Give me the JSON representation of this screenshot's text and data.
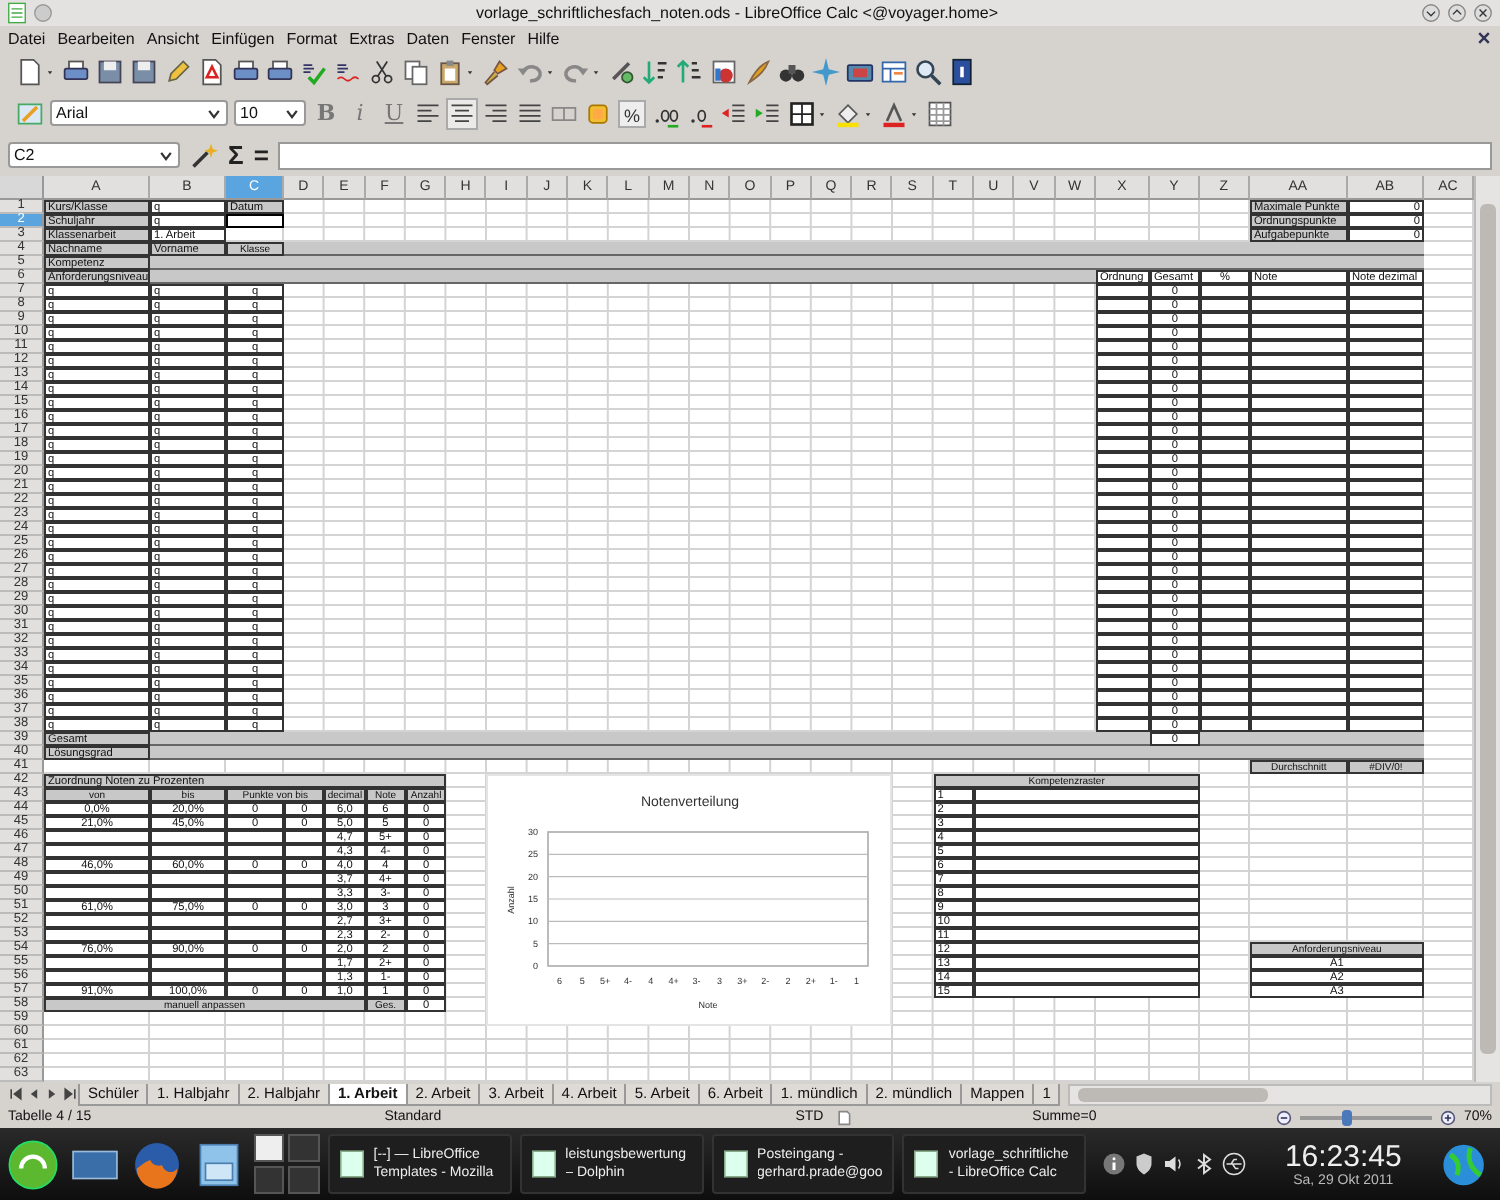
{
  "window": {
    "title": "vorlage_schriftlichesfach_noten.ods - LibreOffice Calc <@voyager.home>"
  },
  "menu": [
    "Datei",
    "Bearbeiten",
    "Ansicht",
    "Einfügen",
    "Format",
    "Extras",
    "Daten",
    "Fenster",
    "Hilfe"
  ],
  "format_toolbar": {
    "font_name": "Arial",
    "font_size": "10",
    "style_buttons": [
      {
        "label": "B",
        "kind": "bold"
      },
      {
        "label": "i",
        "kind": "italic"
      },
      {
        "label": "U",
        "kind": "underline"
      }
    ],
    "percent_button": "%"
  },
  "formula_bar": {
    "name_box": "C2",
    "buttons": [
      "Σ",
      "="
    ]
  },
  "sheet": {
    "columns": [
      {
        "label": "A",
        "selected": false
      },
      {
        "label": "B",
        "selected": false
      },
      {
        "label": "C",
        "selected": true
      },
      {
        "label": "D",
        "selected": false
      },
      {
        "label": "E",
        "selected": false
      },
      {
        "label": "F",
        "selected": false
      },
      {
        "label": "G",
        "selected": false
      },
      {
        "label": "H",
        "selected": false
      },
      {
        "label": "I",
        "selected": false
      },
      {
        "label": "J",
        "selected": false
      },
      {
        "label": "K",
        "selected": false
      },
      {
        "label": "L",
        "selected": false
      },
      {
        "label": "M",
        "selected": false
      },
      {
        "label": "N",
        "selected": false
      },
      {
        "label": "O",
        "selected": false
      },
      {
        "label": "P",
        "selected": false
      },
      {
        "label": "Q",
        "selected": false
      },
      {
        "label": "R",
        "selected": false
      },
      {
        "label": "S",
        "selected": false
      },
      {
        "label": "T",
        "selected": false
      },
      {
        "label": "U",
        "selected": false
      },
      {
        "label": "V",
        "selected": false
      },
      {
        "label": "W",
        "selected": false
      },
      {
        "label": "X",
        "selected": false
      },
      {
        "label": "Y",
        "selected": false
      },
      {
        "label": "Z",
        "selected": false
      },
      {
        "label": "AA",
        "selected": false
      },
      {
        "label": "AB",
        "selected": false
      },
      {
        "label": "AC",
        "selected": false
      }
    ],
    "row_numbers": [
      {
        "number": "1",
        "selected": false
      },
      {
        "number": "2",
        "selected": true
      },
      {
        "number": "3",
        "selected": false
      },
      {
        "number": "4",
        "selected": false
      },
      {
        "number": "5",
        "selected": false
      },
      {
        "number": "6",
        "selected": false
      },
      {
        "number": "7",
        "selected": false
      },
      {
        "number": "8",
        "selected": false
      },
      {
        "number": "9",
        "selected": false
      },
      {
        "number": "10",
        "selected": false
      },
      {
        "number": "11",
        "selected": false
      },
      {
        "number": "12",
        "selected": false
      },
      {
        "number": "13",
        "selected": false
      },
      {
        "number": "14",
        "selected": false
      },
      {
        "number": "15",
        "selected": false
      },
      {
        "number": "16",
        "selected": false
      },
      {
        "number": "17",
        "selected": false
      },
      {
        "number": "18",
        "selected": false
      },
      {
        "number": "19",
        "selected": false
      },
      {
        "number": "20",
        "selected": false
      },
      {
        "number": "21",
        "selected": false
      },
      {
        "number": "22",
        "selected": false
      },
      {
        "number": "23",
        "selected": false
      },
      {
        "number": "24",
        "selected": false
      },
      {
        "number": "25",
        "selected": false
      },
      {
        "number": "26",
        "selected": false
      },
      {
        "number": "27",
        "selected": false
      },
      {
        "number": "28",
        "selected": false
      },
      {
        "number": "29",
        "selected": false
      },
      {
        "number": "30",
        "selected": false
      },
      {
        "number": "31",
        "selected": false
      },
      {
        "number": "32",
        "selected": false
      },
      {
        "number": "33",
        "selected": false
      },
      {
        "number": "34",
        "selected": false
      },
      {
        "number": "35",
        "selected": false
      },
      {
        "number": "36",
        "selected": false
      },
      {
        "number": "37",
        "selected": false
      },
      {
        "number": "38",
        "selected": false
      },
      {
        "number": "39",
        "selected": false
      },
      {
        "number": "40",
        "selected": false
      },
      {
        "number": "41",
        "selected": false
      },
      {
        "number": "42",
        "selected": false
      },
      {
        "number": "43",
        "selected": false
      },
      {
        "number": "44",
        "selected": false
      },
      {
        "number": "45",
        "selected": false
      },
      {
        "number": "46",
        "selected": false
      },
      {
        "number": "47",
        "selected": false
      },
      {
        "number": "48",
        "selected": false
      },
      {
        "number": "49",
        "selected": false
      },
      {
        "number": "50",
        "selected": false
      },
      {
        "number": "51",
        "selected": false
      },
      {
        "number": "52",
        "selected": false
      },
      {
        "number": "53",
        "selected": false
      },
      {
        "number": "54",
        "selected": false
      },
      {
        "number": "55",
        "selected": false
      },
      {
        "number": "56",
        "selected": false
      },
      {
        "number": "57",
        "selected": false
      },
      {
        "number": "58",
        "selected": false
      },
      {
        "number": "59",
        "selected": false
      },
      {
        "number": "60",
        "selected": false
      },
      {
        "number": "61",
        "selected": false
      },
      {
        "number": "62",
        "selected": false
      },
      {
        "number": "63",
        "selected": false
      }
    ],
    "blocks": [
      {
        "kind": "info",
        "rows": [
          {
            "label": "Kurs/Klasse",
            "value": "q",
            "date_label": "Datum"
          },
          {
            "label": "Schuljahr",
            "value": "q"
          },
          {
            "label": "Klassenarbeit",
            "value": "1. Arbeit"
          }
        ]
      },
      {
        "kind": "settings",
        "rows": [
          {
            "label": "Maximale Punkte",
            "value": "0"
          },
          {
            "label": "Ordnungspunkte",
            "value": "0"
          },
          {
            "label": "Aufgabepunkte",
            "value": "0"
          }
        ]
      },
      {
        "kind": "students",
        "headers": [
          "Nachname",
          "Vorname",
          "Klasse"
        ],
        "band_labels": [
          "Kompetenz",
          "Anforderungsniveau"
        ],
        "score_headers": [
          "Ordnung",
          "Gesamt",
          "%",
          "Note",
          "Note dezimal"
        ],
        "entries": [
          {
            "last_name": "q",
            "first_name": "q",
            "class": "q",
            "total": "0"
          },
          {
            "last_name": "q",
            "first_name": "q",
            "class": "q",
            "total": "0"
          },
          {
            "last_name": "q",
            "first_name": "q",
            "class": "q",
            "total": "0"
          },
          {
            "last_name": "q",
            "first_name": "q",
            "class": "q",
            "total": "0"
          },
          {
            "last_name": "q",
            "first_name": "q",
            "class": "q",
            "total": "0"
          },
          {
            "last_name": "q",
            "first_name": "q",
            "class": "q",
            "total": "0"
          },
          {
            "last_name": "q",
            "first_name": "q",
            "class": "q",
            "total": "0"
          },
          {
            "last_name": "q",
            "first_name": "q",
            "class": "q",
            "total": "0"
          },
          {
            "last_name": "q",
            "first_name": "q",
            "class": "q",
            "total": "0"
          },
          {
            "last_name": "q",
            "first_name": "q",
            "class": "q",
            "total": "0"
          },
          {
            "last_name": "q",
            "first_name": "q",
            "class": "q",
            "total": "0"
          },
          {
            "last_name": "q",
            "first_name": "q",
            "class": "q",
            "total": "0"
          },
          {
            "last_name": "q",
            "first_name": "q",
            "class": "q",
            "total": "0"
          },
          {
            "last_name": "q",
            "first_name": "q",
            "class": "q",
            "total": "0"
          },
          {
            "last_name": "q",
            "first_name": "q",
            "class": "q",
            "total": "0"
          },
          {
            "last_name": "q",
            "first_name": "q",
            "class": "q",
            "total": "0"
          },
          {
            "last_name": "q",
            "first_name": "q",
            "class": "q",
            "total": "0"
          },
          {
            "last_name": "q",
            "first_name": "q",
            "class": "q",
            "total": "0"
          },
          {
            "last_name": "q",
            "first_name": "q",
            "class": "q",
            "total": "0"
          },
          {
            "last_name": "q",
            "first_name": "q",
            "class": "q",
            "total": "0"
          },
          {
            "last_name": "q",
            "first_name": "q",
            "class": "q",
            "total": "0"
          },
          {
            "last_name": "q",
            "first_name": "q",
            "class": "q",
            "total": "0"
          },
          {
            "last_name": "q",
            "first_name": "q",
            "class": "q",
            "total": "0"
          },
          {
            "last_name": "q",
            "first_name": "q",
            "class": "q",
            "total": "0"
          },
          {
            "last_name": "q",
            "first_name": "q",
            "class": "q",
            "total": "0"
          },
          {
            "last_name": "q",
            "first_name": "q",
            "class": "q",
            "total": "0"
          },
          {
            "last_name": "q",
            "first_name": "q",
            "class": "q",
            "total": "0"
          },
          {
            "last_name": "q",
            "first_name": "q",
            "class": "q",
            "total": "0"
          },
          {
            "last_name": "q",
            "first_name": "q",
            "class": "q",
            "total": "0"
          },
          {
            "last_name": "q",
            "first_name": "q",
            "class": "q",
            "total": "0"
          },
          {
            "last_name": "q",
            "first_name": "q",
            "class": "q",
            "total": "0"
          },
          {
            "last_name": "q",
            "first_name": "q",
            "class": "q",
            "total": "0"
          }
        ],
        "summary": [
          {
            "label": "Gesamt",
            "total": "0"
          },
          {
            "label": "Lösungsgrad"
          }
        ]
      },
      {
        "kind": "average",
        "label": "Durchschnitt",
        "value": "#DIV/0!"
      },
      {
        "kind": "grades",
        "title": "Zuordnung Noten zu Prozenten",
        "headers": [
          "von",
          "bis",
          "Punkte von bis",
          "decimal",
          "Note",
          "Anzahl"
        ],
        "rows": [
          {
            "from": "0,0%",
            "to": "20,0%",
            "points_from": "0",
            "points_to": "0",
            "decimal": "6,0",
            "grade": "6",
            "count": "0"
          },
          {
            "from": "21,0%",
            "to": "45,0%",
            "points_from": "0",
            "points_to": "0",
            "decimal": "5,0",
            "grade": "5",
            "count": "0"
          },
          {
            "decimal": "4,7",
            "grade": "5+",
            "count": "0"
          },
          {
            "decimal": "4,3",
            "grade": "4-",
            "count": "0"
          },
          {
            "from": "46,0%",
            "to": "60,0%",
            "points_from": "0",
            "points_to": "0",
            "decimal": "4,0",
            "grade": "4",
            "count": "0"
          },
          {
            "decimal": "3,7",
            "grade": "4+",
            "count": "0"
          },
          {
            "decimal": "3,3",
            "grade": "3-",
            "count": "0"
          },
          {
            "from": "61,0%",
            "to": "75,0%",
            "points_from": "0",
            "points_to": "0",
            "decimal": "3,0",
            "grade": "3",
            "count": "0"
          },
          {
            "decimal": "2,7",
            "grade": "3+",
            "count": "0"
          },
          {
            "decimal": "2,3",
            "grade": "2-",
            "count": "0"
          },
          {
            "from": "76,0%",
            "to": "90,0%",
            "points_from": "0",
            "points_to": "0",
            "decimal": "2,0",
            "grade": "2",
            "count": "0"
          },
          {
            "decimal": "1,7",
            "grade": "2+",
            "count": "0"
          },
          {
            "decimal": "1,3",
            "grade": "1-",
            "count": "0"
          },
          {
            "from": "91,0%",
            "to": "100,0%",
            "points_from": "0",
            "points_to": "0",
            "decimal": "1,0",
            "grade": "1",
            "count": "0"
          }
        ],
        "footer": {
          "label": "manuell anpassen",
          "total_label": "Ges.",
          "total": "0"
        }
      },
      {
        "kind": "competencies",
        "title": "Kompetenzraster",
        "items": [
          "1",
          "2",
          "3",
          "4",
          "5",
          "6",
          "7",
          "8",
          "9",
          "10",
          "11",
          "12",
          "13",
          "14",
          "15"
        ]
      },
      {
        "kind": "levels",
        "title": "Anforderungsniveau",
        "items": [
          "A1",
          "A2",
          "A3"
        ]
      }
    ],
    "chart_data": {
      "type": "bar",
      "title": "Notenverteilung",
      "xlabel": "Note",
      "ylabel": "Anzahl",
      "categories": [
        "6",
        "5",
        "5+",
        "4-",
        "4",
        "4+",
        "3-",
        "3",
        "3+",
        "2-",
        "2",
        "2+",
        "1-",
        "1"
      ],
      "values": [
        0,
        0,
        0,
        0,
        0,
        0,
        0,
        0,
        0,
        0,
        0,
        0,
        0,
        0
      ],
      "ylim": [
        0,
        30
      ],
      "yticks": [
        0,
        5,
        10,
        15,
        20,
        25,
        30
      ],
      "grid": true
    }
  },
  "sheet_tabs": [
    {
      "label": "Schüler",
      "selected": false
    },
    {
      "label": "1. Halbjahr",
      "selected": false
    },
    {
      "label": "2. Halbjahr",
      "selected": false
    },
    {
      "label": "1. Arbeit",
      "selected": true
    },
    {
      "label": "2. Arbeit",
      "selected": false
    },
    {
      "label": "3. Arbeit",
      "selected": false
    },
    {
      "label": "4. Arbeit",
      "selected": false
    },
    {
      "label": "5. Arbeit",
      "selected": false
    },
    {
      "label": "6. Arbeit",
      "selected": false
    },
    {
      "label": "1. mündlich",
      "selected": false
    },
    {
      "label": "2. mündlich",
      "selected": false
    },
    {
      "label": "Mappen",
      "selected": false
    },
    {
      "label": "1",
      "selected": false
    }
  ],
  "status_bar": {
    "sheet": "Tabelle 4 / 15",
    "page_style": "Standard",
    "mode": "STD",
    "sum": "Summe=0",
    "zoom": {
      "level": 0.35,
      "reading": "70%"
    }
  },
  "taskbar": {
    "tasks": [
      {
        "title": "[--] — LibreOffice",
        "subtitle": "Templates - Mozilla"
      },
      {
        "title": "leistungsbewertung",
        "subtitle": "– Dolphin"
      },
      {
        "title": "Posteingang -",
        "subtitle": "gerhard.prade@goo"
      },
      {
        "title": "vorlage_schriftliche",
        "subtitle": "- LibreOffice Calc"
      }
    ],
    "clock": "16:23:45",
    "date": "Sa, 29 Okt 2011"
  }
}
